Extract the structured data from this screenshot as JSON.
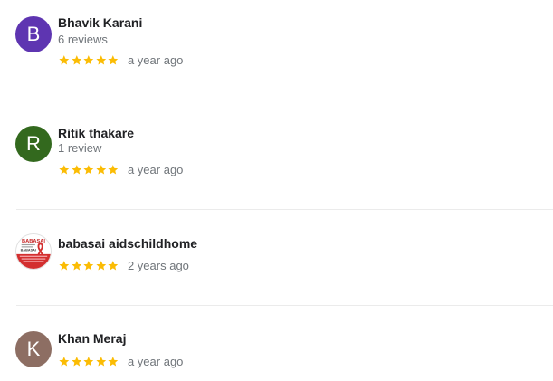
{
  "reviews": [
    {
      "avatar_letter": "B",
      "avatar_color": "#5e35b1",
      "name": "Bhavik Karani",
      "count": "6 reviews",
      "stars": 5,
      "when": "a year ago"
    },
    {
      "avatar_letter": "R",
      "avatar_color": "#33691e",
      "name": "Ritik thakare",
      "count": "1 review",
      "stars": 5,
      "when": "a year ago"
    },
    {
      "avatar_logo": "babasai-logo",
      "logo_text": "BABASAI",
      "name": "babasai aidschildhome",
      "stars": 5,
      "when": "2 years ago"
    },
    {
      "avatar_letter": "K",
      "avatar_color": "#8d6e63",
      "name": "Khan Meraj",
      "stars": 5,
      "when": "a year ago"
    }
  ],
  "colors": {
    "star": "#fbbc04",
    "secondary_text": "#70757a",
    "divider": "#ebebeb"
  },
  "icons": {
    "star": "star-icon"
  }
}
